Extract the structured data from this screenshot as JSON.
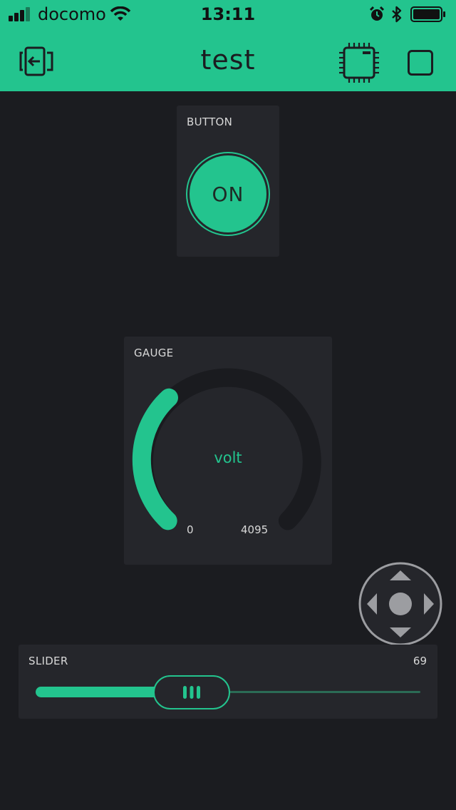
{
  "status_bar": {
    "carrier": "docomo",
    "time": "13:11"
  },
  "header": {
    "title": "test"
  },
  "button_widget": {
    "label": "BUTTON",
    "button_text": "ON"
  },
  "gauge_widget": {
    "label": "GAUGE",
    "unit": "volt",
    "min": "0",
    "max": "4095"
  },
  "slider_widget": {
    "label": "SLIDER",
    "value": "69",
    "level": 0.4
  },
  "colors": {
    "accent": "#23c48e",
    "background": "#1b1c20",
    "widget": "#25262b"
  }
}
